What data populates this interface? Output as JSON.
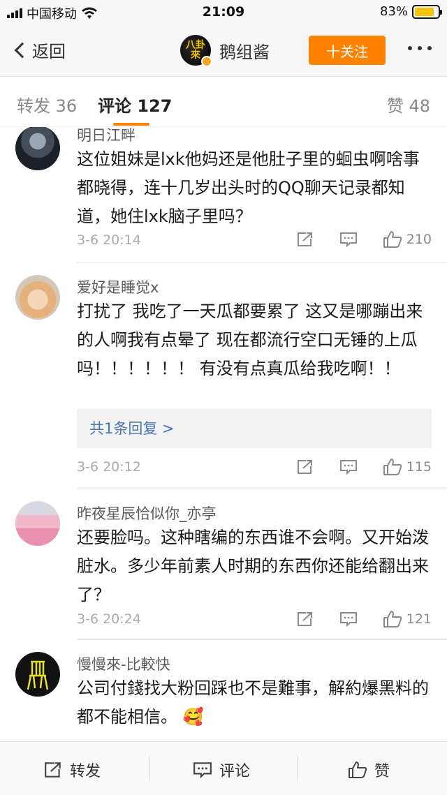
{
  "status_bar": {
    "carrier": "中国移动",
    "time": "21:09",
    "battery": "83%",
    "battery_level": 0.83
  },
  "nav": {
    "back_label": "返回",
    "title": "鹅组酱",
    "follow_label": "十关注",
    "accent_color": "#ff8200"
  },
  "tabs": [
    {
      "label": "转发 36"
    },
    {
      "label": "评论 127"
    },
    {
      "label": "赞 48"
    }
  ],
  "comments": [
    {
      "name": "明日江畔",
      "text": "这位姐妹是lxk他妈还是他肚子里的蛔虫啊啥事都晓得，连十几岁出头时的QQ聊天记录都知道，她住lxk脑子里吗？",
      "time": "3-6 20:14",
      "likes": "210"
    },
    {
      "name": "爱好是睡觉x",
      "text": "打扰了 我吃了一天瓜都要累了 这又是哪蹦出来的人啊我有点晕了 现在都流行空口无锤的上瓜吗！！！！！！ 有没有点真瓜给我吃啊！！",
      "reply": "共1条回复 >",
      "time": "3-6 20:12",
      "likes": "115"
    },
    {
      "name": "昨夜星辰恰似你_亦亭",
      "text": "还要脸吗。这种瞎编的东西谁不会啊。又开始泼脏水。多少年前素人时期的东西你还能给翻出来了？",
      "time": "3-6 20:24",
      "likes": "121"
    },
    {
      "name": "慢慢來-比較快",
      "text": "公司付錢找大粉回踩也不是難事，解約爆黑料的都不能相信。",
      "emoji": "🥰"
    }
  ],
  "bottom_bar": {
    "repost_label": "转发",
    "comment_label": "评论",
    "like_label": "赞"
  }
}
